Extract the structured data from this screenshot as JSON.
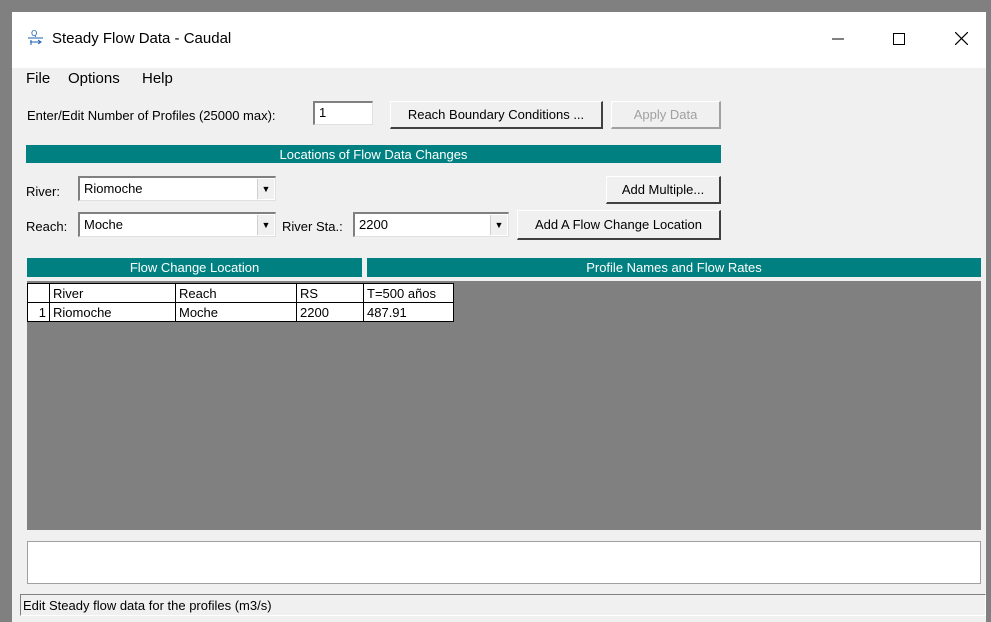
{
  "window": {
    "title": "Steady Flow Data - Caudal",
    "app_icon": "hec-ras-flow-icon",
    "minimize_icon": "minimize-icon",
    "maximize_icon": "maximize-icon",
    "close_icon": "close-icon"
  },
  "menu": {
    "items": [
      "File",
      "Options",
      "Help"
    ]
  },
  "profiles": {
    "label": "Enter/Edit Number of Profiles (25000 max):",
    "value": "1"
  },
  "buttons": {
    "reach_boundary": "Reach Boundary Conditions ...",
    "apply_data": "Apply Data",
    "add_multiple": "Add Multiple...",
    "add_flow_change": "Add A Flow Change Location"
  },
  "locations": {
    "header": "Locations of Flow Data Changes",
    "river_label": "River:",
    "river_value": "Riomoche",
    "reach_label": "Reach:",
    "reach_value": "Moche",
    "river_sta_label": "River Sta.:",
    "river_sta_value": "2200"
  },
  "table": {
    "left_header": "Flow Change Location",
    "right_header": "Profile Names and Flow Rates",
    "columns": [
      "River",
      "Reach",
      "RS",
      "T=500 años"
    ],
    "rows": [
      {
        "index": "1",
        "river": "Riomoche",
        "reach": "Moche",
        "rs": "2200",
        "flow": "487.91"
      }
    ]
  },
  "status_bar": {
    "text": "Edit Steady flow data for the profiles (m3/s)"
  },
  "colors": {
    "header_teal": "#008080",
    "grid_bg": "#808080",
    "window_bg": "#f0f0f0"
  }
}
